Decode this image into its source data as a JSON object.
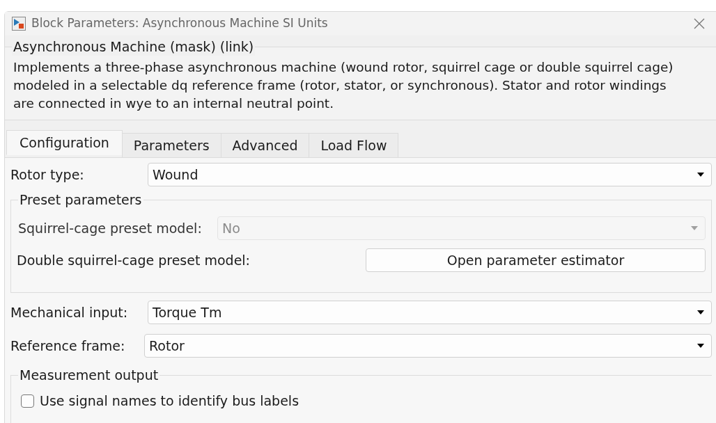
{
  "window": {
    "title": "Block Parameters: Asynchronous Machine SI Units"
  },
  "description": {
    "title": "Asynchronous Machine (mask) (link)",
    "lines": [
      "Implements a three-phase asynchronous machine (wound rotor, squirrel cage or double squirrel cage)",
      "modeled in a selectable dq reference frame (rotor, stator, or synchronous). Stator and rotor windings",
      "are connected in wye to an internal neutral point."
    ]
  },
  "tabs": [
    {
      "label": "Configuration",
      "selected": true
    },
    {
      "label": "Parameters",
      "selected": false
    },
    {
      "label": "Advanced",
      "selected": false
    },
    {
      "label": "Load Flow",
      "selected": false
    }
  ],
  "rotor_type": {
    "label": "Rotor type:",
    "value": "Wound"
  },
  "preset_parameters": {
    "title": "Preset parameters",
    "squirrel_cage": {
      "label": "Squirrel-cage preset model:",
      "value": "No",
      "disabled": true
    },
    "double_squirrel_cage": {
      "label": "Double squirrel-cage preset model:",
      "button": "Open parameter estimator"
    }
  },
  "mechanical_input": {
    "label": "Mechanical input:",
    "value": "Torque Tm"
  },
  "reference_frame": {
    "label": "Reference frame:",
    "value": "Rotor"
  },
  "measurement_output": {
    "title": "Measurement output",
    "checkbox": {
      "label": "Use signal names to identify bus labels",
      "checked": false
    }
  }
}
